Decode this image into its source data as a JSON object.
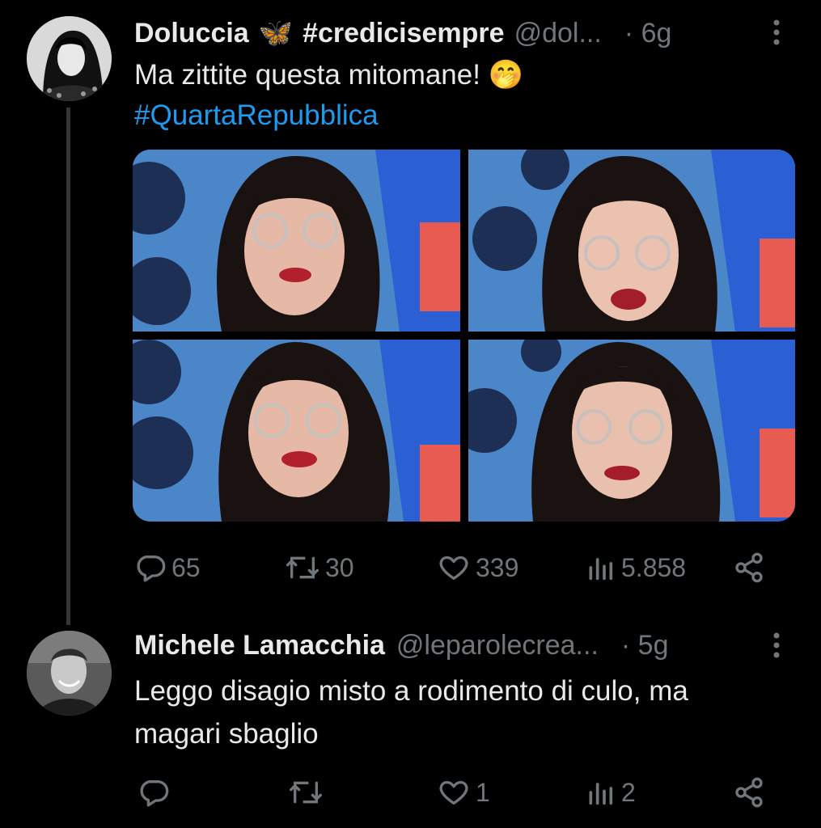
{
  "tweets": [
    {
      "author": {
        "name": "Doluccia",
        "emoji": "🦋",
        "hashtag_in_name": "#credicisempre",
        "handle": "@dol...",
        "time": "· 6g"
      },
      "text": "Ma zittite questa mitomane! 🤭",
      "hashtag": "#QuartaRepubblica",
      "media_count": 4,
      "actions": {
        "replies": "65",
        "retweets": "30",
        "likes": "339",
        "views": "5.858"
      }
    },
    {
      "author": {
        "name": "Michele Lamacchia",
        "handle": "@leparolecrea...",
        "time": "· 5g"
      },
      "text_line1": "Leggo disagio misto a rodimento di culo, ma",
      "text_line2": "magari sbaglio",
      "actions": {
        "replies": "",
        "retweets": "",
        "likes": "1",
        "views": "2"
      }
    }
  ],
  "icons": {
    "more": "more-icon",
    "reply": "reply-icon",
    "retweet": "retweet-icon",
    "like": "heart-icon",
    "views": "views-icon",
    "share": "share-icon"
  },
  "colors": {
    "background": "#000000",
    "text": "#e7e9ea",
    "muted": "#71767b",
    "link": "#1d9bf0"
  }
}
